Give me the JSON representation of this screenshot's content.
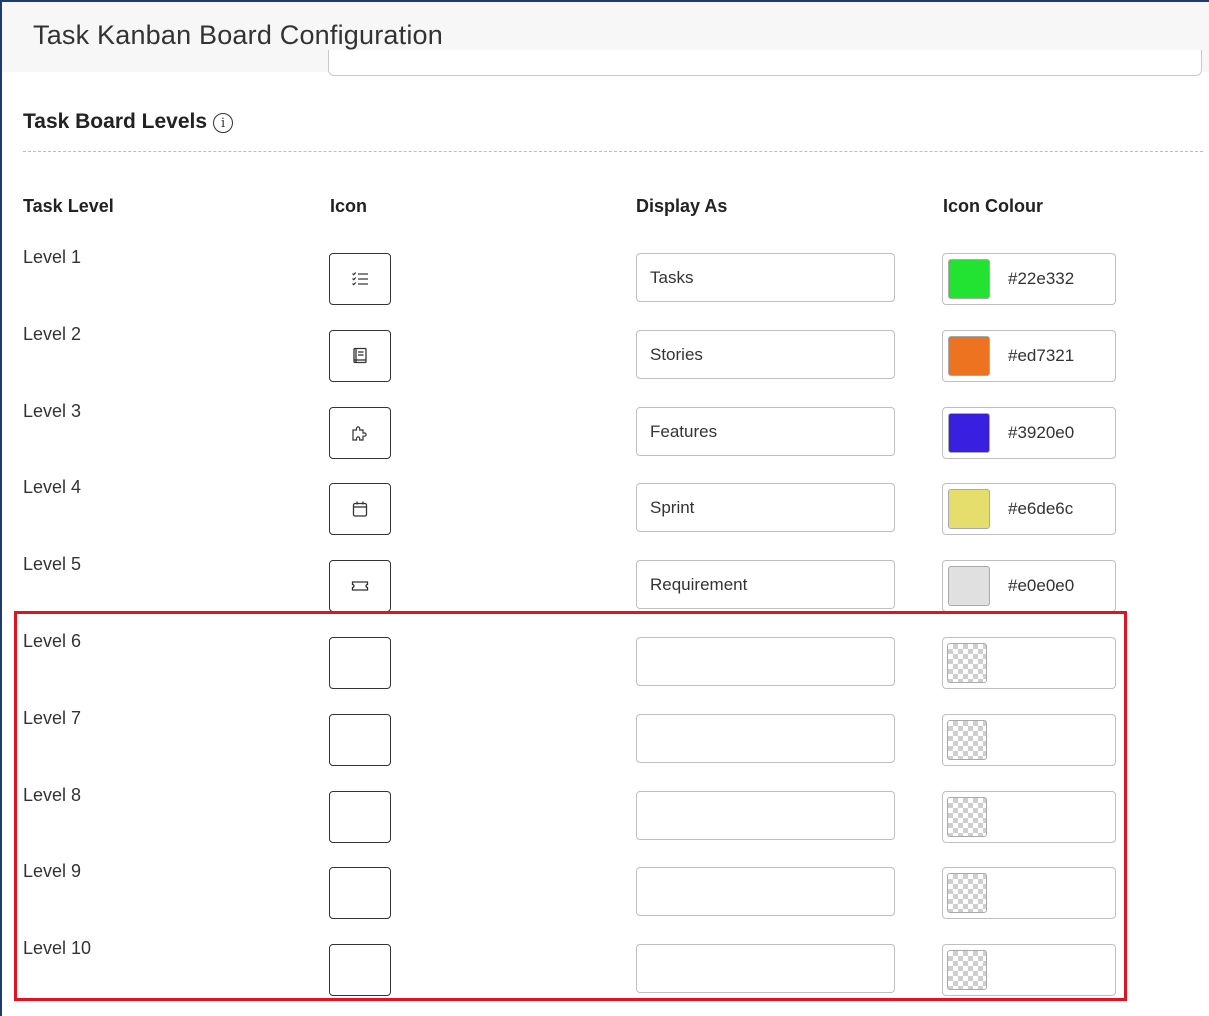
{
  "page": {
    "title": "Task Kanban Board Configuration"
  },
  "section": {
    "title": "Task Board Levels",
    "info_icon": "info-circle-icon"
  },
  "columns": {
    "task_level": "Task Level",
    "icon": "Icon",
    "display_as": "Display As",
    "icon_colour": "Icon Colour"
  },
  "levels": [
    {
      "label": "Level 1",
      "icon": "checklist-icon",
      "display_as": "Tasks",
      "colour": "#22e332"
    },
    {
      "label": "Level 2",
      "icon": "notebook-icon",
      "display_as": "Stories",
      "colour": "#ed7321"
    },
    {
      "label": "Level 3",
      "icon": "puzzle-icon",
      "display_as": "Features",
      "colour": "#3920e0"
    },
    {
      "label": "Level 4",
      "icon": "calendar-icon",
      "display_as": "Sprint",
      "colour": "#e6de6c"
    },
    {
      "label": "Level 5",
      "icon": "ticket-icon",
      "display_as": "Requirement",
      "colour": "#e0e0e0"
    },
    {
      "label": "Level 6",
      "icon": "",
      "display_as": "",
      "colour": ""
    },
    {
      "label": "Level 7",
      "icon": "",
      "display_as": "",
      "colour": ""
    },
    {
      "label": "Level 8",
      "icon": "",
      "display_as": "",
      "colour": ""
    },
    {
      "label": "Level 9",
      "icon": "",
      "display_as": "",
      "colour": ""
    },
    {
      "label": "Level 10",
      "icon": "",
      "display_as": "",
      "colour": ""
    }
  ],
  "highlight": {
    "color": "#e0141c"
  }
}
